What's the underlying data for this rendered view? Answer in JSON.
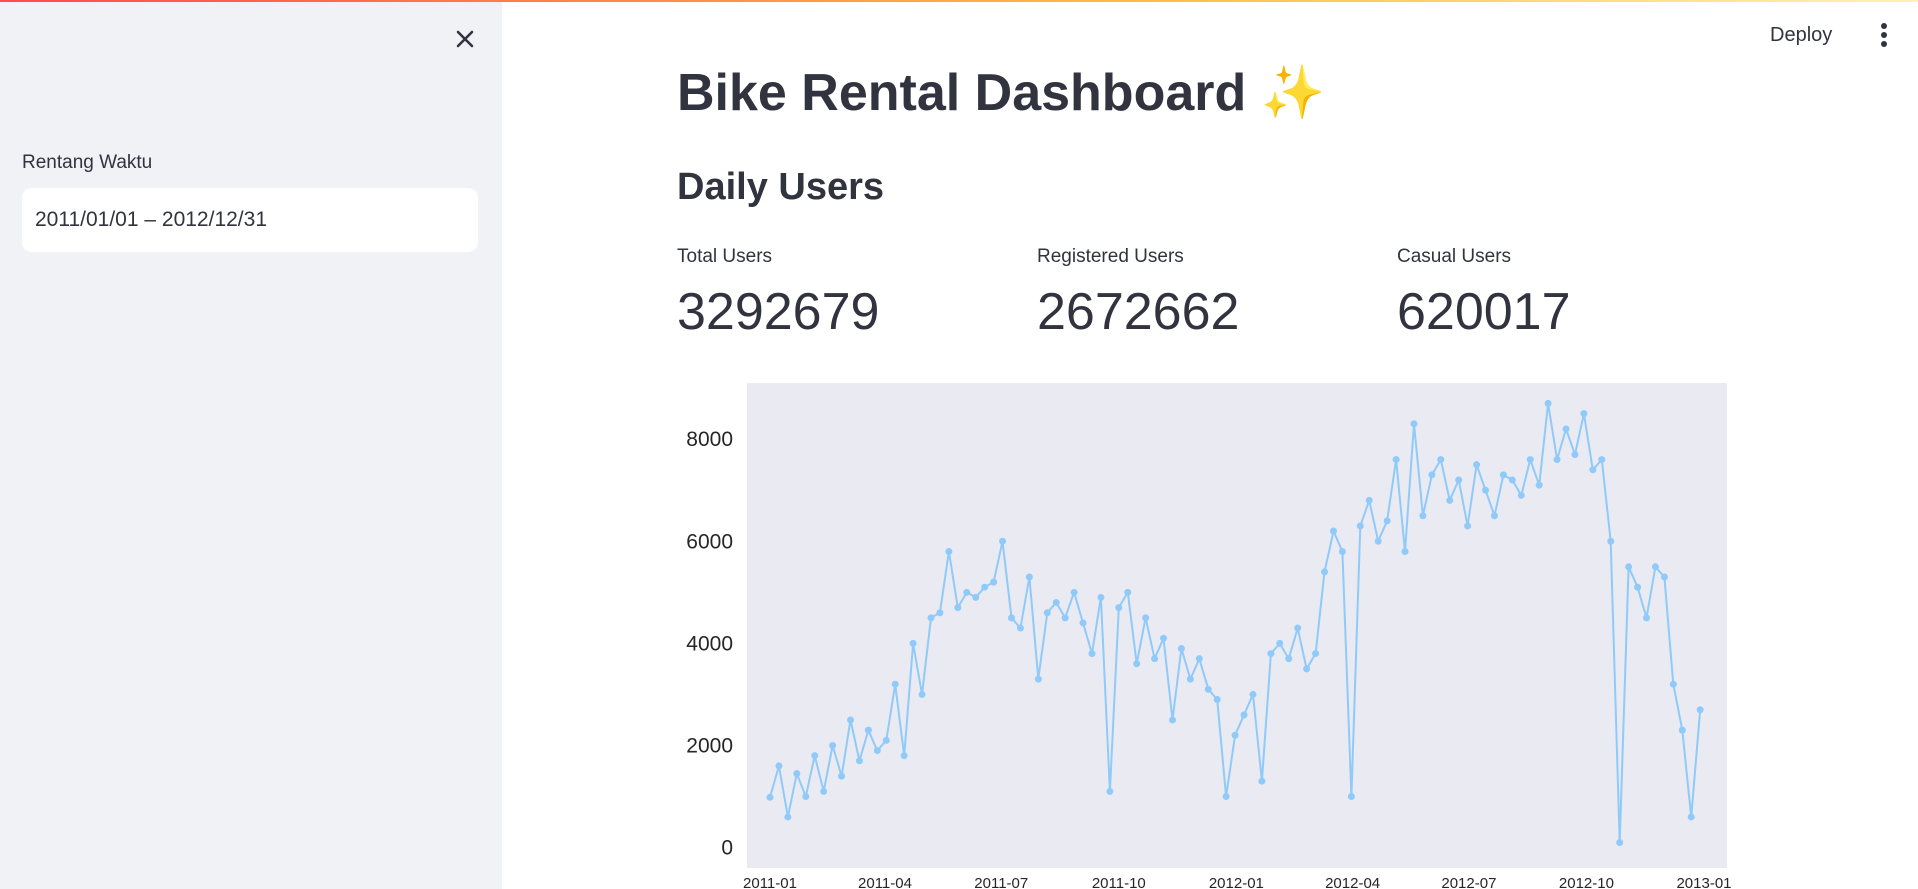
{
  "sidebar": {
    "date_range_label": "Rentang Waktu",
    "date_range_value": "2011/01/01 – 2012/12/31"
  },
  "header": {
    "deploy_label": "Deploy"
  },
  "main": {
    "title": "Bike Rental Dashboard",
    "title_emoji": "✨",
    "section_title": "Daily Users",
    "metrics": [
      {
        "label": "Total Users",
        "value": "3292679"
      },
      {
        "label": "Registered Users",
        "value": "2672662"
      },
      {
        "label": "Casual Users",
        "value": "620017"
      }
    ]
  },
  "colors": {
    "sidebar_bg": "#f0f2f6",
    "plot_bg": "#eaeaf2",
    "series": "#90caf9",
    "text": "#31333f"
  },
  "chart_data": {
    "type": "line",
    "title": "",
    "xlabel": "",
    "ylabel": "",
    "ylim": [
      -400,
      9100
    ],
    "yticks": [
      0,
      2000,
      4000,
      6000,
      8000
    ],
    "xlim": [
      "2010-12-14",
      "2013-01-19"
    ],
    "xticks": [
      "2011-01",
      "2011-04",
      "2011-07",
      "2011-10",
      "2012-01",
      "2012-04",
      "2012-07",
      "2012-10",
      "2013-01"
    ],
    "markers": true,
    "series": [
      {
        "x": [
          "2011-01-01",
          "2011-01-08",
          "2011-01-15",
          "2011-01-22",
          "2011-01-29",
          "2011-02-05",
          "2011-02-12",
          "2011-02-19",
          "2011-02-26",
          "2011-03-05",
          "2011-03-12",
          "2011-03-19",
          "2011-03-26",
          "2011-04-02",
          "2011-04-09",
          "2011-04-16",
          "2011-04-23",
          "2011-04-30",
          "2011-05-07",
          "2011-05-14",
          "2011-05-21",
          "2011-05-28",
          "2011-06-04",
          "2011-06-11",
          "2011-06-18",
          "2011-06-25",
          "2011-07-02",
          "2011-07-09",
          "2011-07-16",
          "2011-07-23",
          "2011-07-30",
          "2011-08-06",
          "2011-08-13",
          "2011-08-20",
          "2011-08-27",
          "2011-09-03",
          "2011-09-10",
          "2011-09-17",
          "2011-09-24",
          "2011-10-01",
          "2011-10-08",
          "2011-10-15",
          "2011-10-22",
          "2011-10-29",
          "2011-11-05",
          "2011-11-12",
          "2011-11-19",
          "2011-11-26",
          "2011-12-03",
          "2011-12-10",
          "2011-12-17",
          "2011-12-24",
          "2011-12-31",
          "2012-01-07",
          "2012-01-14",
          "2012-01-21",
          "2012-01-28",
          "2012-02-04",
          "2012-02-11",
          "2012-02-18",
          "2012-02-25",
          "2012-03-03",
          "2012-03-10",
          "2012-03-17",
          "2012-03-24",
          "2012-03-31",
          "2012-04-07",
          "2012-04-14",
          "2012-04-21",
          "2012-04-28",
          "2012-05-05",
          "2012-05-12",
          "2012-05-19",
          "2012-05-26",
          "2012-06-02",
          "2012-06-09",
          "2012-06-16",
          "2012-06-23",
          "2012-06-30",
          "2012-07-07",
          "2012-07-14",
          "2012-07-21",
          "2012-07-28",
          "2012-08-04",
          "2012-08-11",
          "2012-08-18",
          "2012-08-25",
          "2012-09-01",
          "2012-09-08",
          "2012-09-15",
          "2012-09-22",
          "2012-09-29",
          "2012-10-06",
          "2012-10-13",
          "2012-10-20",
          "2012-10-27",
          "2012-11-03",
          "2012-11-10",
          "2012-11-17",
          "2012-11-24",
          "2012-12-01",
          "2012-12-08",
          "2012-12-15",
          "2012-12-22",
          "2012-12-29"
        ],
        "y": [
          985,
          1600,
          600,
          1450,
          1000,
          1800,
          1100,
          2000,
          1400,
          2500,
          1700,
          2300,
          1900,
          2100,
          3200,
          1800,
          4000,
          3000,
          4500,
          4600,
          5800,
          4700,
          5000,
          4900,
          5100,
          5200,
          6000,
          4500,
          4300,
          5300,
          3300,
          4600,
          4800,
          4500,
          5000,
          4400,
          3800,
          4900,
          1100,
          4700,
          5000,
          3600,
          4500,
          3700,
          4100,
          2500,
          3900,
          3300,
          3700,
          3100,
          2900,
          1000,
          2200,
          2600,
          3000,
          1300,
          3800,
          4000,
          3700,
          4300,
          3500,
          3800,
          5400,
          6200,
          5800,
          1000,
          6300,
          6800,
          6000,
          6400,
          7600,
          5800,
          8300,
          6500,
          7300,
          7600,
          6800,
          7200,
          6300,
          7500,
          7000,
          6500,
          7300,
          7200,
          6900,
          7600,
          7100,
          8700,
          7600,
          8200,
          7700,
          8500,
          7400,
          7600,
          6000,
          100,
          5500,
          5100,
          4500,
          5500,
          5300,
          3200,
          2300,
          600,
          2700
        ]
      }
    ]
  }
}
